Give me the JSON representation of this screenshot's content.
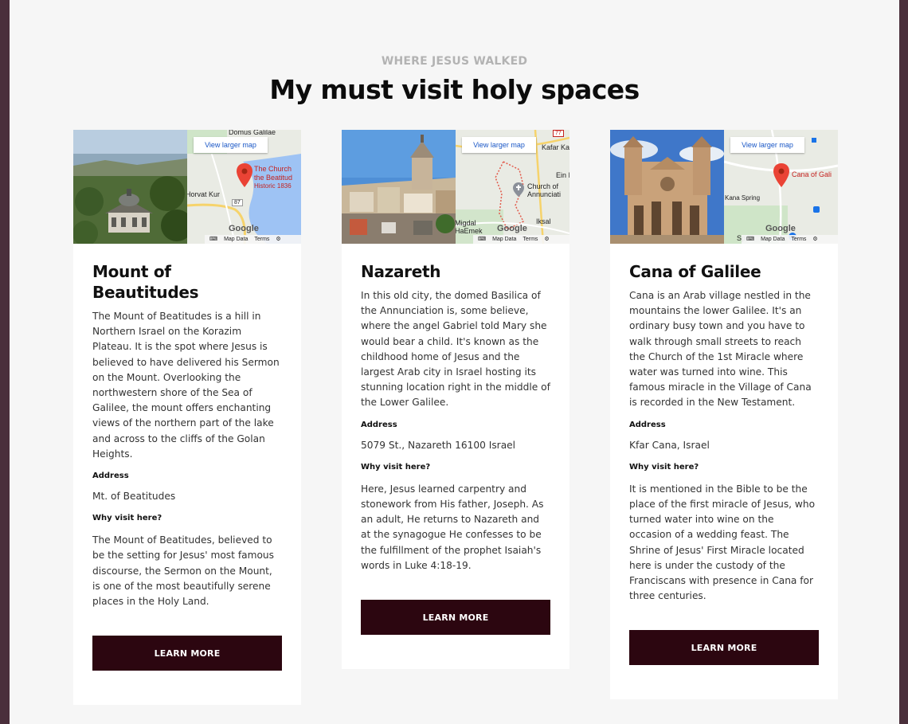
{
  "section": {
    "eyebrow": "WHERE JESUS WALKED",
    "heading": "My must visit holy spaces"
  },
  "map_ui": {
    "larger_map": "View larger map",
    "logo": "Google",
    "map_data": "Map Data",
    "terms": "Terms"
  },
  "colors": {
    "background": "#f6f6f6",
    "frame": "#4a2f3b",
    "button": "#2c0610",
    "eyebrow": "#b3b3b3"
  },
  "cards": [
    {
      "title": "Mount of Beautitudes",
      "description": "The Mount of Beatitudes is a hill in Northern Israel on the Korazim Plateau. It is the spot where Jesus is believed to have delivered his Sermon on the Mount. Overlooking the northwestern shore of the Sea of Galilee, the mount offers enchanting views of the northern part of the lake and across to the cliffs of the Golan Heights.",
      "address_label": "Address",
      "address": "Mt. of Beatitudes",
      "why_label": "Why visit here?",
      "why": "The Mount of Beatitudes, believed to be the setting for Jesus' most famous discourse, the Sermon on the Mount, is one of the most beautifully serene places in the Holy Land.",
      "button": "LEARN MORE",
      "map_labels": {
        "top": "Domus Galilae",
        "place": "The Church",
        "place2": "the Beatitud",
        "place3": "Historic 1836",
        "side": "Horvat Kur",
        "road": "87"
      }
    },
    {
      "title": "Nazareth",
      "description": "In this old city, the domed Basilica of the Annunciation is, some believe, where the angel Gabriel told Mary she would bear a child. It's known as the childhood home of Jesus and the largest Arab city in Israel hosting its stunning location right in the middle of the Lower Galilee.",
      "address_label": "Address",
      "address": "5079 St., Nazareth 16100 Israel",
      "why_label": "Why visit here?",
      "why": "Here, Jesus learned carpentry and stonework from His father, Joseph. As an adult, He returns to Nazareth and at the synagogue He confesses to be the fulfillment of the prophet Isaiah's words in Luke 4:18-19.",
      "button": "LEARN MORE",
      "map_labels": {
        "top": "Kafar Ka",
        "place": "Church of",
        "place2": "Annunciati",
        "side": "Ein I",
        "side2": "Migdal",
        "side3": "HaEmek",
        "side4": "Iksal",
        "road": "77"
      }
    },
    {
      "title": "Cana of Galilee",
      "description": "Cana is an Arab village nestled in the mountains the lower Galilee. It's an ordinary busy town and you have to walk through small streets to reach the Church of the 1st Miracle where water was turned into wine. This famous miracle in the Village of Cana is recorded in the New Testament.",
      "address_label": "Address",
      "address": "Kfar Cana, Israel",
      "why_label": "Why visit here?",
      "why": "It is mentioned in the Bible to be the place of the first miracle of Jesus, who turned water into wine on the occasion of a wedding feast. The Shrine of Jesus' First Miracle located here is under the custody of the Franciscans with presence in Cana for three centuries.",
      "button": "LEARN MORE",
      "map_labels": {
        "place": "Cana of Gali",
        "side": "Kana Spring",
        "side2": "Sp"
      }
    }
  ]
}
